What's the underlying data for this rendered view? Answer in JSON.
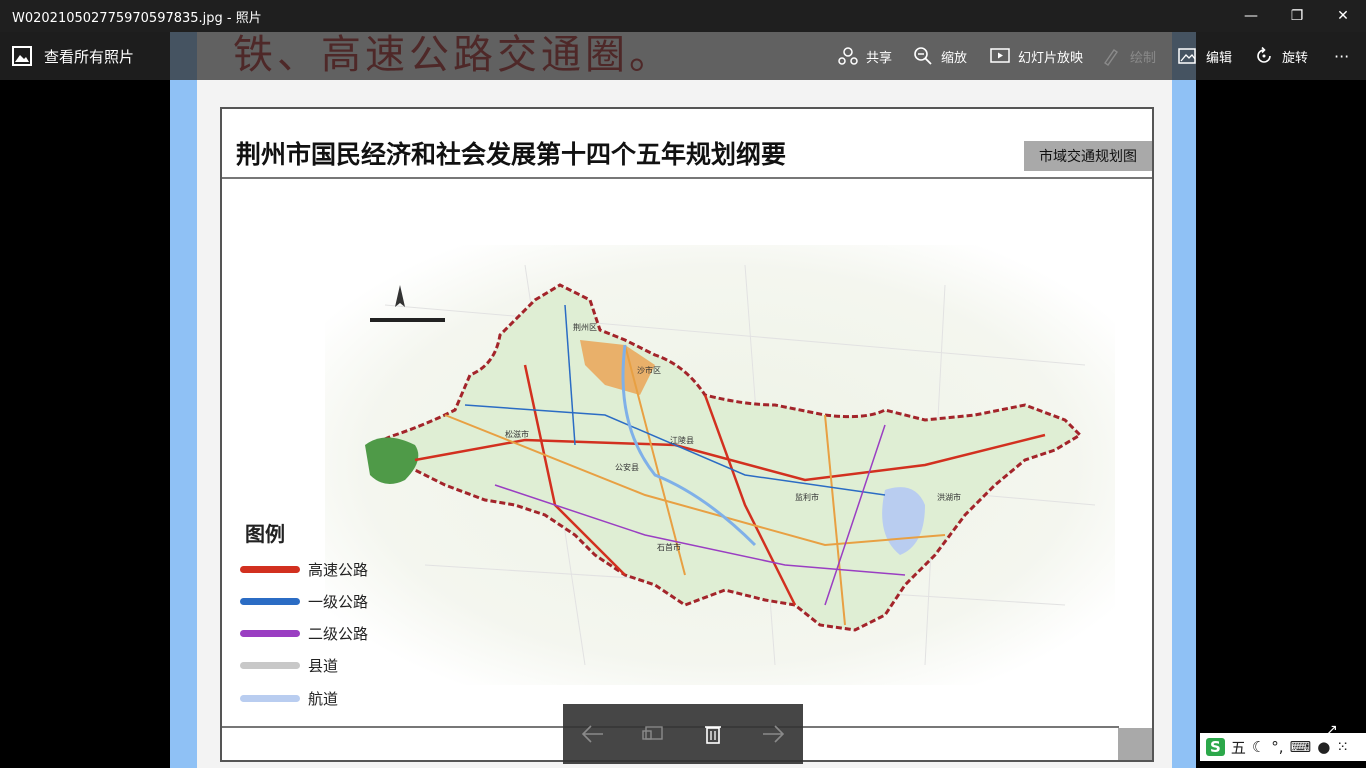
{
  "window": {
    "title": "W020210502775970597835.jpg - 照片",
    "minimize": "—",
    "restore": "❐",
    "close": "✕"
  },
  "toolbar": {
    "all_photos": "查看所有照片",
    "share": "共享",
    "zoom": "缩放",
    "slideshow": "幻灯片放映",
    "draw": "绘制",
    "edit": "编辑",
    "rotate": "旋转",
    "more": "···"
  },
  "image": {
    "banner_text": "铁、高速公路交通圈。",
    "doc_title": "荆州市国民经济和社会发展第十四个五年规划纲要",
    "doc_tag": "市域交通规划图",
    "legend": {
      "title": "图例",
      "items": [
        {
          "label": "高速公路",
          "color": "#d2301f"
        },
        {
          "label": "一级公路",
          "color": "#2b6cc4"
        },
        {
          "label": "二级公路",
          "color": "#9a3ec2"
        },
        {
          "label": "县道",
          "color": "#c8c8c8"
        },
        {
          "label": "航道",
          "color": "#b9cdf0"
        }
      ]
    },
    "map_labels": {
      "city1": "沙市区",
      "city2": "荆州区",
      "city3": "松滋市",
      "city4": "公安县",
      "city5": "江陵县",
      "city6": "监利市",
      "city7": "洪湖市",
      "city8": "石首市"
    }
  },
  "ime": {
    "mode": "五",
    "logo": "S"
  },
  "colors": {
    "accent": "#8fc1f5",
    "map_border": "#a3242a",
    "urban": "#e9b06a"
  }
}
